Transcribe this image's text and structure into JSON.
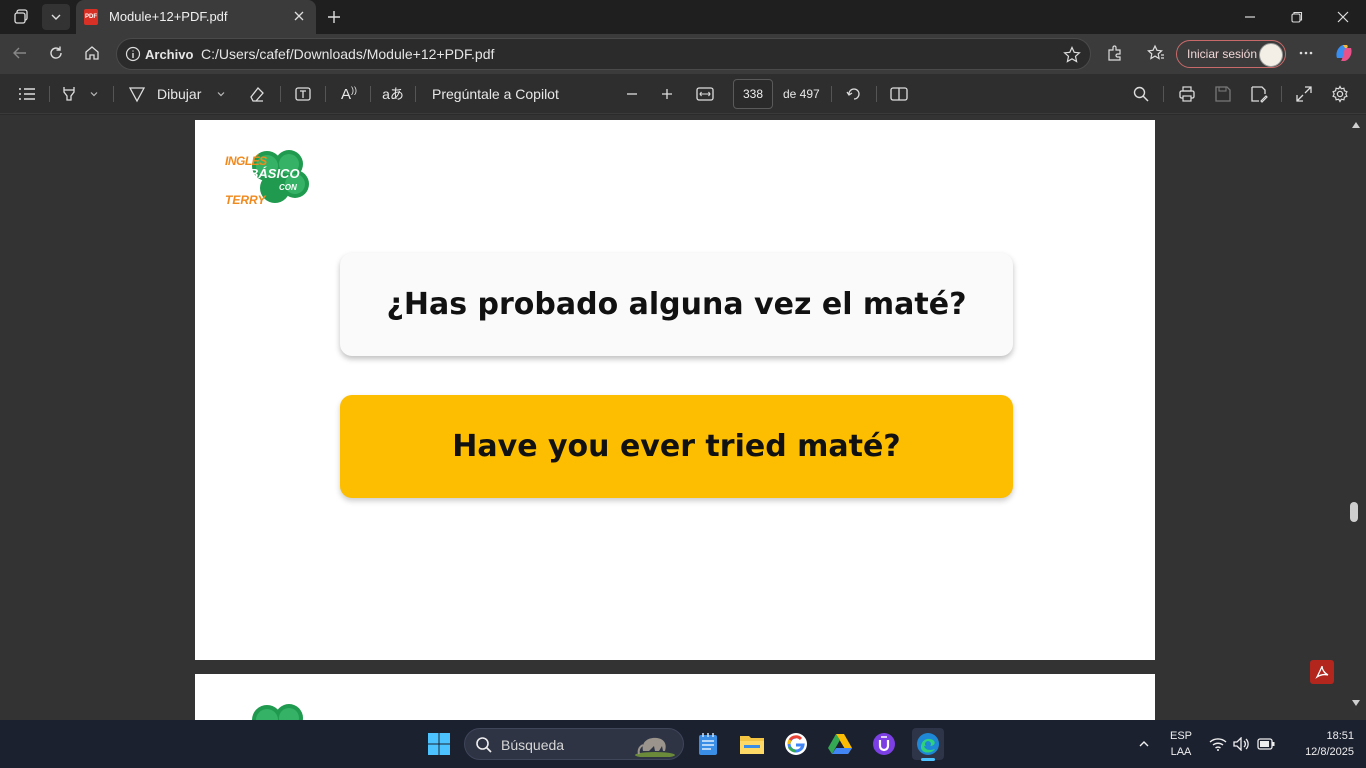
{
  "browser": {
    "tab_title": "Module+12+PDF.pdf",
    "site_label": "Archivo",
    "url": "C:/Users/cafef/Downloads/Module+12+PDF.pdf",
    "signin_label": "Iniciar sesión"
  },
  "pdf_toolbar": {
    "draw_label": "Dibujar",
    "ask_copilot_label": "Pregúntale a Copilot",
    "current_page": "338",
    "page_total_label": "de 497"
  },
  "page": {
    "logo": {
      "line1": "INGLÉS",
      "line2": "BÁSICO",
      "line3": "CON",
      "line4": "TERRY"
    },
    "question": "¿Has probado alguna vez el maté?",
    "answer": "Have you ever tried maté?"
  },
  "taskbar": {
    "search_label": "Búsqueda",
    "lang_line1": "ESP",
    "lang_line2": "LAA",
    "time": "18:51",
    "date": "12/8/2025"
  },
  "colors": {
    "answer_card": "#fdbd00",
    "question_card": "#fafafa",
    "logo_orange": "#f08a1e",
    "logo_green": "#1f9a4e"
  }
}
